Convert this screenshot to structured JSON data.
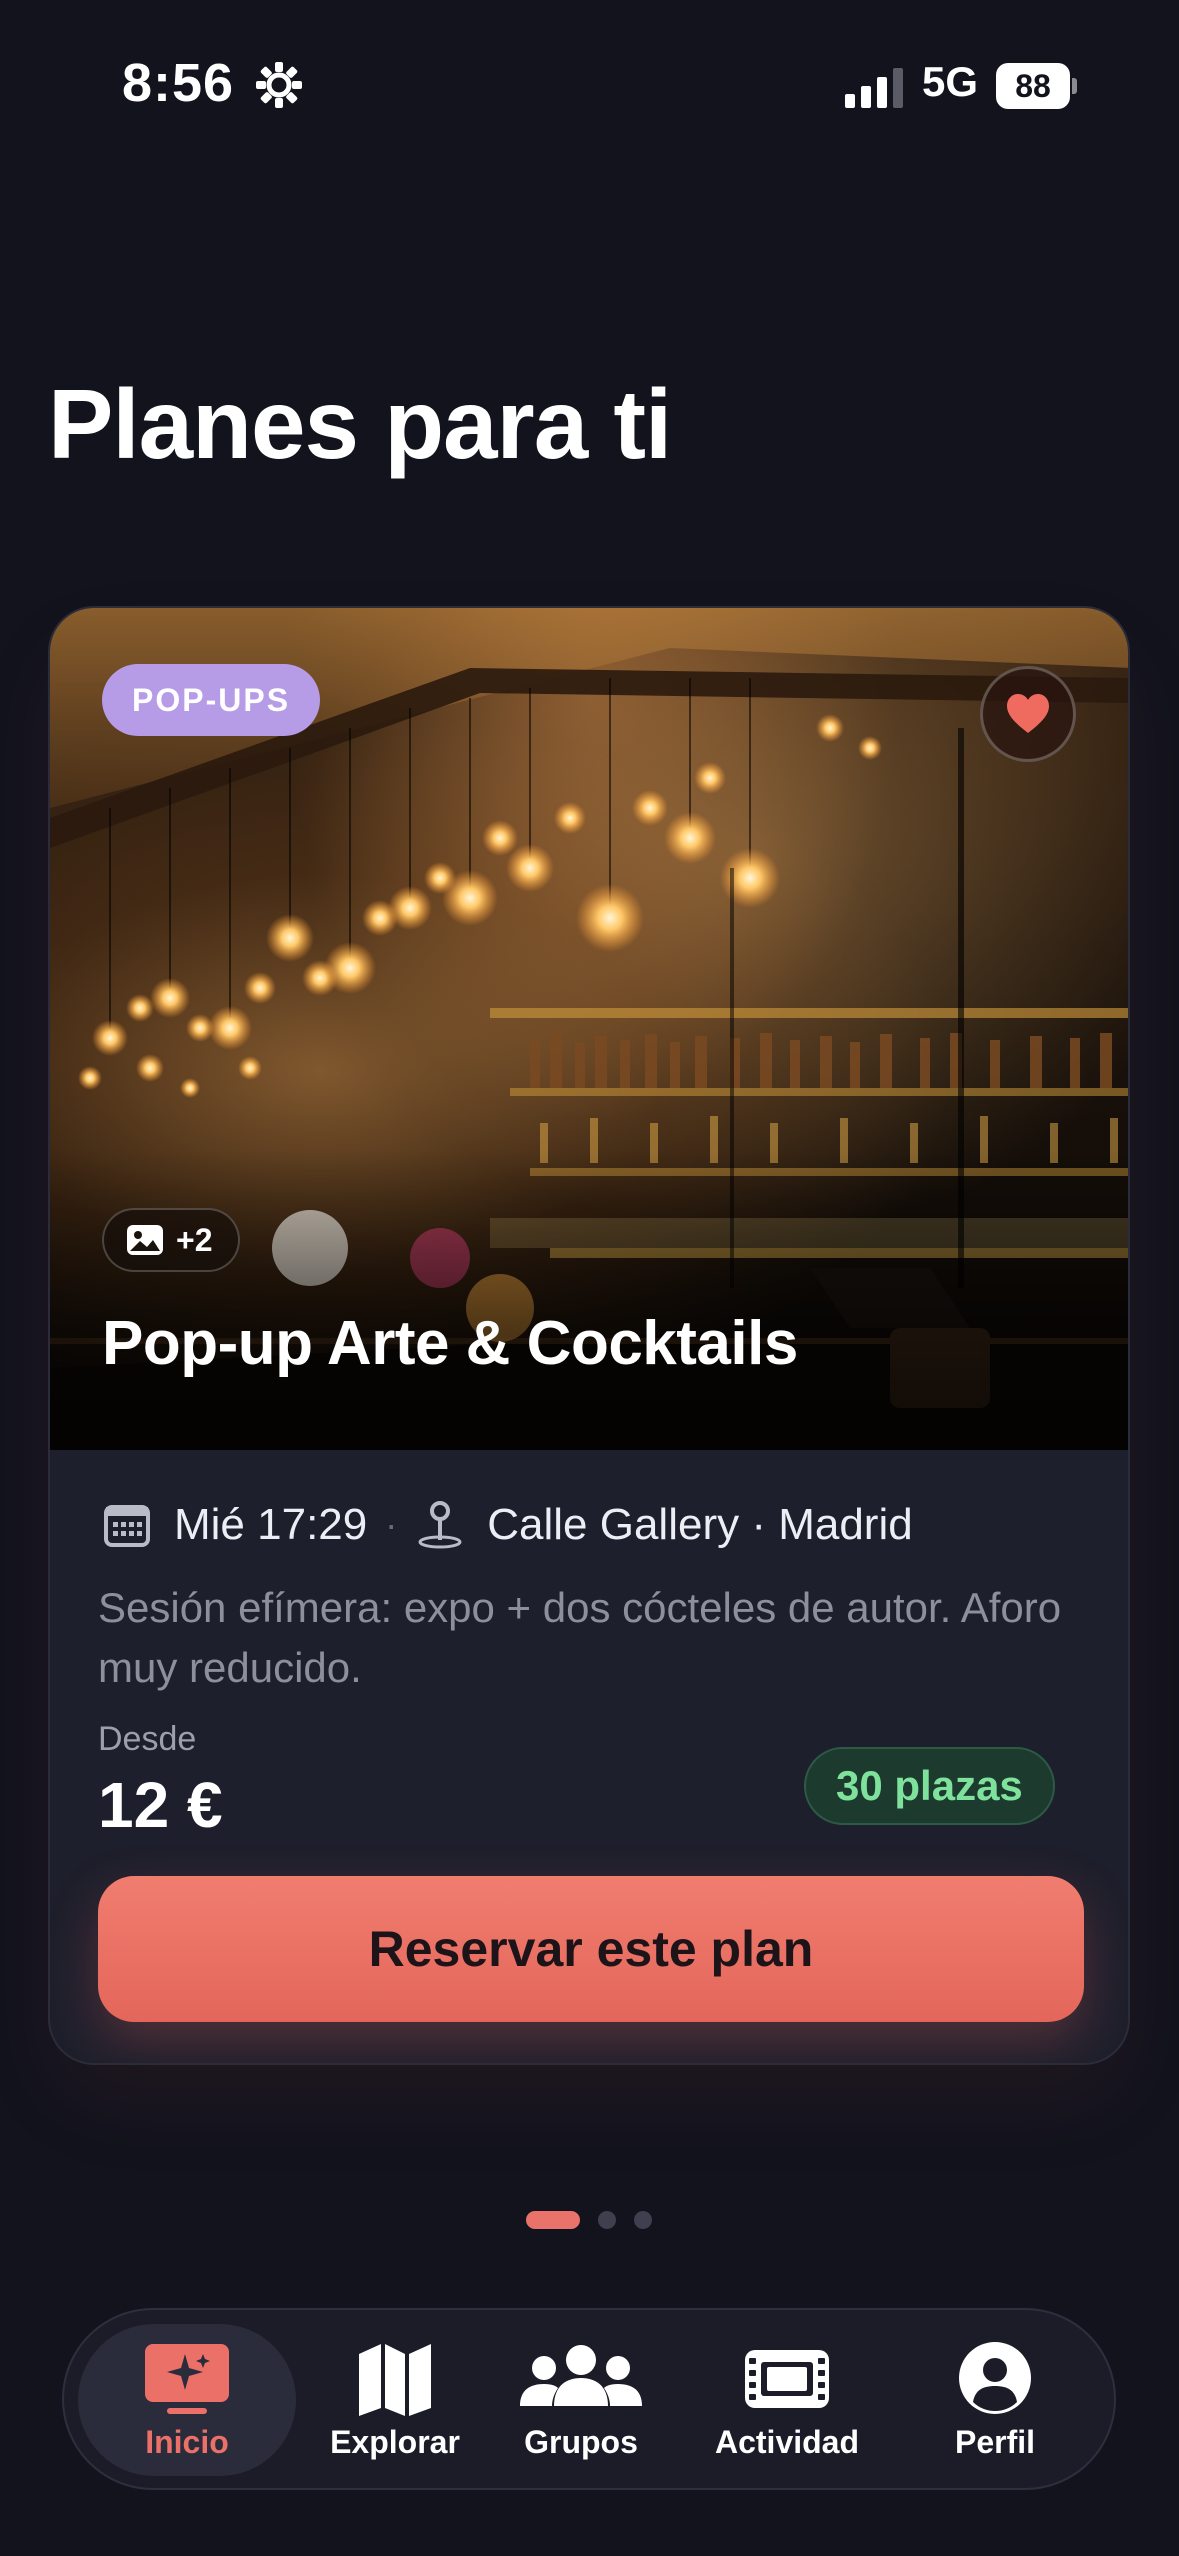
{
  "status_bar": {
    "time": "8:56",
    "network": "5G",
    "battery": "88"
  },
  "page_title": "Planes para ti",
  "plan": {
    "category": "POP-UPS",
    "photo_count": "+2",
    "title": "Pop-up Arte & Cocktails",
    "datetime": "Mié 17:29",
    "separator": "·",
    "location": "Calle Gallery · Madrid",
    "description": "Sesión efímera: expo + dos cócteles de autor. Aforo muy reducido.",
    "price_label": "Desde",
    "price": "12 €",
    "seats": "30 plazas",
    "cta": "Reservar este plan",
    "favorited": true
  },
  "pager": {
    "total": 3,
    "active": 1
  },
  "tabs": [
    {
      "label": "Inicio",
      "icon": "sparkle-screen-icon",
      "active": true
    },
    {
      "label": "Explorar",
      "icon": "map-icon",
      "active": false
    },
    {
      "label": "Grupos",
      "icon": "people-icon",
      "active": false
    },
    {
      "label": "Actividad",
      "icon": "ticket-icon",
      "active": false
    },
    {
      "label": "Perfil",
      "icon": "profile-icon",
      "active": false
    }
  ],
  "colors": {
    "background": "#12131d",
    "card": "#1e1f2c",
    "accent": "#e9736a",
    "chip": "#b69be6",
    "seats_text": "#7ee29c",
    "seats_bg": "#1d3a2e"
  }
}
